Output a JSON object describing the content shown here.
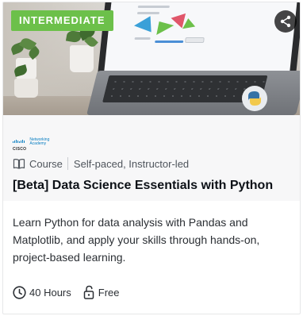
{
  "card": {
    "badge": "INTERMEDIATE",
    "provider": {
      "name": "CISCO",
      "sub_line1": "Networking",
      "sub_line2": "Academy"
    },
    "type_label": "Course",
    "delivery": "Self-paced, Instructor-led",
    "title": "[Beta] Data Science Essentials with Python",
    "description": "Learn Python for data analysis with Pandas and Matplotlib, and apply your skills through hands-on, project-based learning.",
    "duration": "40 Hours",
    "price": "Free"
  },
  "icons": {
    "share": "share-icon",
    "course": "book-icon",
    "duration": "clock-icon",
    "price": "unlock-icon"
  },
  "colors": {
    "badge": "#6cc04a",
    "badge_text": "#ffffff",
    "share_bg": "#000000",
    "title": "#0d1117",
    "cisco_blue": "#0a7fc2"
  }
}
